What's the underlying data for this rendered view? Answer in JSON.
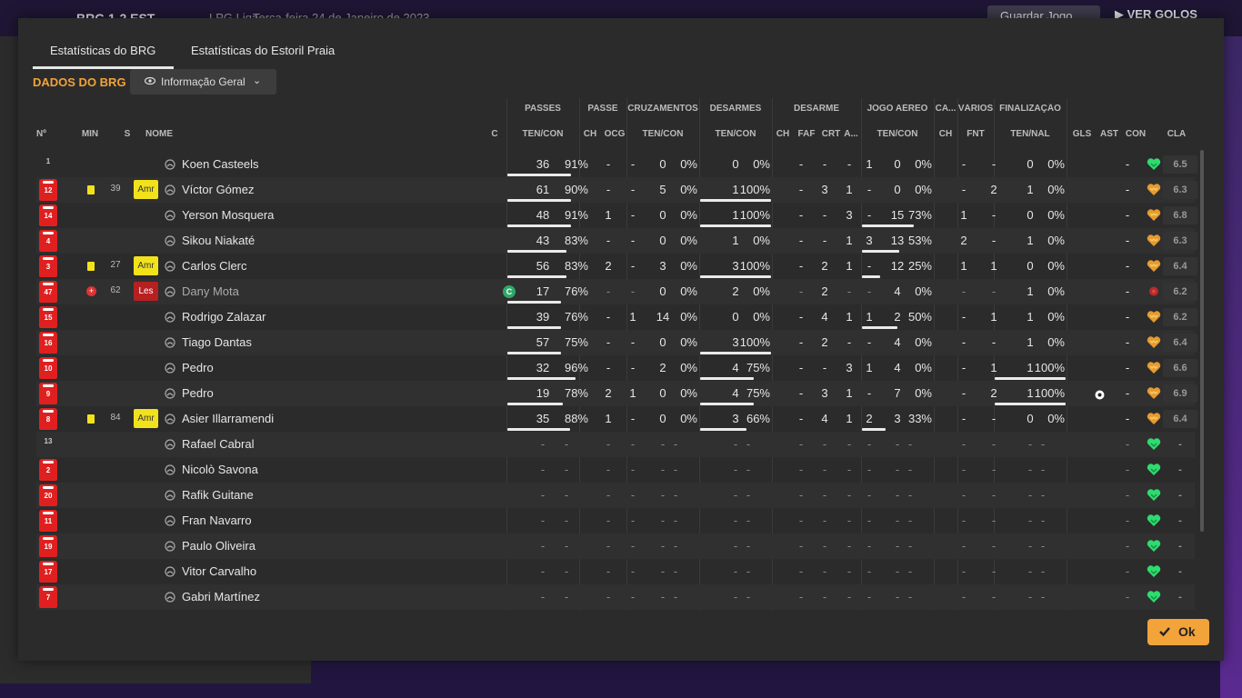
{
  "background": {
    "score": "BRG 1-2 EST",
    "competition": "LPG Liga",
    "date": "Terça-feira 24 de Janeiro de 2023",
    "save_label": "Guardar Jogo",
    "goals_label": "VER GOLOS"
  },
  "tabs": [
    {
      "label": "Estatísticas do BRG",
      "active": true
    },
    {
      "label": "Estatísticas do Estoril Praia",
      "active": false
    }
  ],
  "section_title": "DADOS DO BRG",
  "view_dropdown": {
    "label": "Informação Geral"
  },
  "group_headers": [
    "PASSES",
    "PASSE",
    "CRUZAMENTOS",
    "DESARMES",
    "DESARME",
    "JOGO AÉREO",
    "CA...",
    "VÁRIOS",
    "FINALIZAÇÃO"
  ],
  "columns": [
    "Nº",
    "MIN",
    "S",
    "NOME",
    "C",
    "TEN/CON",
    "CH",
    "OCG",
    "TEN/CON",
    "TEN/CON",
    "CH",
    "FAF",
    "CRT",
    "A...",
    "TEN/CON",
    "CH",
    "FNT",
    "TEN/NAL",
    "GLS",
    "AST",
    "CON",
    "CLA"
  ],
  "colors": {
    "accent": "#f2a33a",
    "shirt": "#e02020",
    "yellow_card": "#f2e21b",
    "condition_green": "#2edb6e",
    "condition_orange": "#e79a2f"
  },
  "players": [
    {
      "num": "1",
      "gk": true,
      "card": "",
      "min": "",
      "sub": "",
      "name": "Koen Casteels",
      "c": "",
      "p": [
        "36",
        "91%",
        0.9
      ],
      "pch": "-",
      "ocg": "-",
      "cr": [
        "0",
        "0%",
        0
      ],
      "ds": [
        "0",
        "0%",
        0
      ],
      "dch": "-",
      "faf": "-",
      "crt": "-",
      "da": "1",
      "ja": [
        "0",
        "0%",
        0
      ],
      "ca": "-",
      "fnt": "-",
      "fin": [
        "0",
        "0%",
        0
      ],
      "gls": "",
      "ast": "-",
      "con": "green",
      "cla": "6.5"
    },
    {
      "num": "12",
      "card": "yellow",
      "min": "39",
      "sub": "Amr",
      "name": "Víctor Gómez",
      "c": "",
      "p": [
        "61",
        "90%",
        0.9
      ],
      "pch": "-",
      "ocg": "-",
      "cr": [
        "5",
        "0%",
        0
      ],
      "ds": [
        "1",
        "100%",
        1
      ],
      "dch": "-",
      "faf": "3",
      "crt": "1",
      "da": "-",
      "ja": [
        "0",
        "0%",
        0
      ],
      "ca": "-",
      "fnt": "2",
      "fin": [
        "1",
        "0%",
        0
      ],
      "gls": "",
      "ast": "-",
      "con": "orange",
      "cla": "6.3"
    },
    {
      "num": "14",
      "card": "",
      "min": "",
      "sub": "",
      "name": "Yerson Mosquera",
      "c": "",
      "p": [
        "48",
        "91%",
        0.9
      ],
      "pch": "1",
      "ocg": "-",
      "cr": [
        "0",
        "0%",
        0
      ],
      "ds": [
        "1",
        "100%",
        1
      ],
      "dch": "-",
      "faf": "-",
      "crt": "3",
      "da": "-",
      "ja": [
        "15",
        "73%",
        0.73
      ],
      "ca": "1",
      "fnt": "-",
      "fin": [
        "0",
        "0%",
        0
      ],
      "gls": "",
      "ast": "-",
      "con": "orange",
      "cla": "6.8"
    },
    {
      "num": "4",
      "card": "",
      "min": "",
      "sub": "",
      "name": "Sikou Niakaté",
      "c": "",
      "p": [
        "43",
        "83%",
        0.83
      ],
      "pch": "-",
      "ocg": "-",
      "cr": [
        "0",
        "0%",
        0
      ],
      "ds": [
        "1",
        "0%",
        0
      ],
      "dch": "-",
      "faf": "-",
      "crt": "1",
      "da": "3",
      "ja": [
        "13",
        "53%",
        0.53
      ],
      "ca": "2",
      "fnt": "-",
      "fin": [
        "1",
        "0%",
        0
      ],
      "gls": "",
      "ast": "-",
      "con": "orange",
      "cla": "6.3"
    },
    {
      "num": "3",
      "card": "yellow",
      "min": "27",
      "sub": "Amr",
      "name": "Carlos Clerc",
      "c": "",
      "p": [
        "56",
        "83%",
        0.83
      ],
      "pch": "2",
      "ocg": "-",
      "cr": [
        "3",
        "0%",
        0
      ],
      "ds": [
        "3",
        "100%",
        1
      ],
      "dch": "-",
      "faf": "2",
      "crt": "1",
      "da": "-",
      "ja": [
        "12",
        "25%",
        0.25
      ],
      "ca": "1",
      "fnt": "1",
      "fin": [
        "0",
        "0%",
        0
      ],
      "gls": "",
      "ast": "-",
      "con": "orange",
      "cla": "6.4"
    },
    {
      "num": "47",
      "card": "injury",
      "min": "62",
      "sub": "Les",
      "name": "Dany Mota",
      "c": "C",
      "dim": true,
      "p": [
        "17",
        "76%",
        0.76
      ],
      "pch": "-",
      "ocg": "-",
      "cr": [
        "0",
        "0%",
        0
      ],
      "ds": [
        "2",
        "0%",
        0
      ],
      "dch": "-",
      "faf": "2",
      "crt": "-",
      "da": "-",
      "ja": [
        "4",
        "0%",
        0
      ],
      "ca": "-",
      "fnt": "-",
      "fin": [
        "1",
        "0%",
        0
      ],
      "gls": "",
      "ast": "-",
      "con": "red",
      "cla": "6.2"
    },
    {
      "num": "15",
      "card": "",
      "min": "",
      "sub": "",
      "name": "Rodrigo Zalazar",
      "c": "",
      "p": [
        "39",
        "76%",
        0.76
      ],
      "pch": "-",
      "ocg": "1",
      "cr": [
        "14",
        "0%",
        0
      ],
      "ds": [
        "0",
        "0%",
        0
      ],
      "dch": "-",
      "faf": "4",
      "crt": "1",
      "da": "1",
      "ja": [
        "2",
        "50%",
        0.5
      ],
      "ca": "-",
      "fnt": "1",
      "fin": [
        "1",
        "0%",
        0
      ],
      "gls": "",
      "ast": "-",
      "con": "orange",
      "cla": "6.2"
    },
    {
      "num": "16",
      "card": "",
      "min": "",
      "sub": "",
      "name": "Tiago Dantas",
      "c": "",
      "p": [
        "57",
        "75%",
        0.75
      ],
      "pch": "-",
      "ocg": "-",
      "cr": [
        "0",
        "0%",
        0
      ],
      "ds": [
        "3",
        "100%",
        1
      ],
      "dch": "-",
      "faf": "2",
      "crt": "-",
      "da": "-",
      "ja": [
        "4",
        "0%",
        0
      ],
      "ca": "-",
      "fnt": "-",
      "fin": [
        "1",
        "0%",
        0
      ],
      "gls": "",
      "ast": "-",
      "con": "orange",
      "cla": "6.4"
    },
    {
      "num": "10",
      "card": "",
      "min": "",
      "sub": "",
      "name": "Pedro",
      "c": "",
      "p": [
        "32",
        "96%",
        0.96
      ],
      "pch": "-",
      "ocg": "-",
      "cr": [
        "2",
        "0%",
        0
      ],
      "ds": [
        "4",
        "75%",
        0.75
      ],
      "dch": "-",
      "faf": "-",
      "crt": "3",
      "da": "1",
      "ja": [
        "4",
        "0%",
        0
      ],
      "ca": "-",
      "fnt": "1",
      "fin": [
        "1",
        "100%",
        1
      ],
      "gls": "",
      "ast": "-",
      "con": "orange",
      "cla": "6.6"
    },
    {
      "num": "9",
      "card": "",
      "min": "",
      "sub": "",
      "name": "Pedro",
      "c": "",
      "p": [
        "19",
        "78%",
        0.78
      ],
      "pch": "2",
      "ocg": "1",
      "cr": [
        "0",
        "0%",
        0
      ],
      "ds": [
        "4",
        "75%",
        0.75
      ],
      "dch": "-",
      "faf": "3",
      "crt": "1",
      "da": "-",
      "ja": [
        "7",
        "0%",
        0
      ],
      "ca": "-",
      "fnt": "2",
      "fin": [
        "1",
        "100%",
        1
      ],
      "gls": "ball",
      "ast": "-",
      "con": "orange",
      "cla": "6.9"
    },
    {
      "num": "8",
      "card": "yellow",
      "min": "84",
      "sub": "Amr",
      "name": "Asier Illarramendi",
      "c": "",
      "p": [
        "35",
        "88%",
        0.88
      ],
      "pch": "1",
      "ocg": "-",
      "cr": [
        "0",
        "0%",
        0
      ],
      "ds": [
        "3",
        "66%",
        0.66
      ],
      "dch": "-",
      "faf": "4",
      "crt": "1",
      "da": "2",
      "ja": [
        "3",
        "33%",
        0.33
      ],
      "ca": "-",
      "fnt": "-",
      "fin": [
        "0",
        "0%",
        0
      ],
      "gls": "",
      "ast": "-",
      "con": "orange",
      "cla": "6.4"
    },
    {
      "num": "13",
      "gk": true,
      "bench": true,
      "card": "",
      "min": "",
      "sub": "",
      "name": "Rafael Cabral",
      "c": "",
      "con": "green",
      "cla": "-"
    },
    {
      "num": "2",
      "bench": true,
      "card": "",
      "min": "",
      "sub": "",
      "name": "Nicolò Savona",
      "c": "",
      "con": "green",
      "cla": "-"
    },
    {
      "num": "20",
      "bench": true,
      "card": "",
      "min": "",
      "sub": "",
      "name": "Rafik Guitane",
      "c": "",
      "con": "green",
      "cla": "-"
    },
    {
      "num": "11",
      "bench": true,
      "card": "",
      "min": "",
      "sub": "",
      "name": "Fran Navarro",
      "c": "",
      "con": "green",
      "cla": "-"
    },
    {
      "num": "19",
      "bench": true,
      "card": "",
      "min": "",
      "sub": "",
      "name": "Paulo Oliveira",
      "c": "",
      "con": "green",
      "cla": "-"
    },
    {
      "num": "17",
      "bench": true,
      "card": "",
      "min": "",
      "sub": "",
      "name": "Vitor Carvalho",
      "c": "",
      "con": "green",
      "cla": "-"
    },
    {
      "num": "7",
      "bench": true,
      "card": "",
      "min": "",
      "sub": "",
      "name": "Gabri Martínez",
      "c": "",
      "con": "green",
      "cla": "-"
    }
  ],
  "ok_label": "Ok"
}
